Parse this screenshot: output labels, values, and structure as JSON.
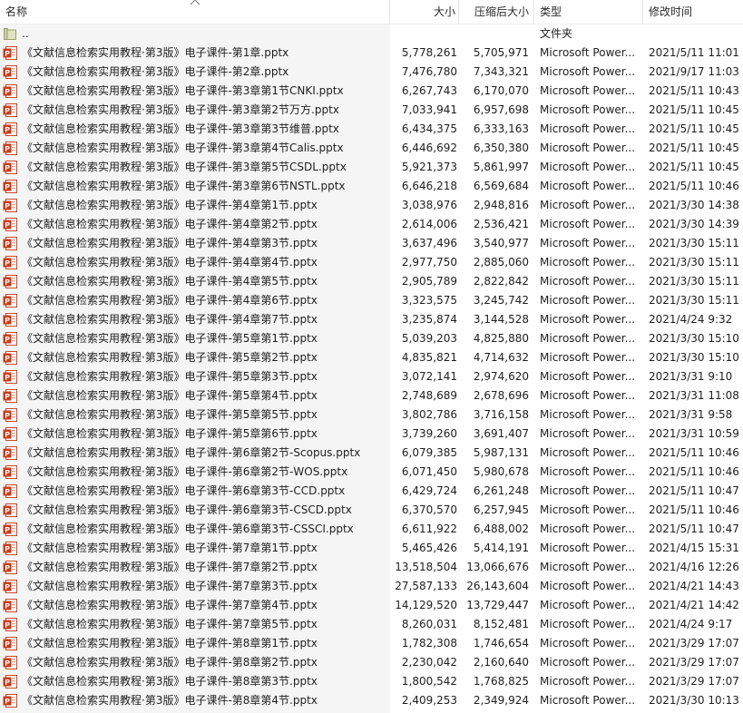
{
  "columns": {
    "name": "名称",
    "size": "大小",
    "compressed": "压缩后大小",
    "type": "类型",
    "modified": "修改时间"
  },
  "parent_row": {
    "name": "..",
    "type": "文件夹",
    "icon": "folder-icon"
  },
  "file_icon": "powerpoint-file-icon",
  "files": [
    {
      "name": "《文献信息检索实用教程·第3版》电子课件-第1章.pptx",
      "size": "5,778,261",
      "compressed": "5,705,971",
      "type": "Microsoft Power...",
      "modified": "2021/5/11 11:01"
    },
    {
      "name": "《文献信息检索实用教程·第3版》电子课件-第2章.pptx",
      "size": "7,476,780",
      "compressed": "7,343,321",
      "type": "Microsoft Power...",
      "modified": "2021/9/17 11:03"
    },
    {
      "name": "《文献信息检索实用教程·第3版》电子课件-第3章第1节CNKI.pptx",
      "size": "6,267,743",
      "compressed": "6,170,070",
      "type": "Microsoft Power...",
      "modified": "2021/5/11 10:43"
    },
    {
      "name": "《文献信息检索实用教程·第3版》电子课件-第3章第2节万方.pptx",
      "size": "7,033,941",
      "compressed": "6,957,698",
      "type": "Microsoft Power...",
      "modified": "2021/5/11 10:45"
    },
    {
      "name": "《文献信息检索实用教程·第3版》电子课件-第3章第3节维普.pptx",
      "size": "6,434,375",
      "compressed": "6,333,163",
      "type": "Microsoft Power...",
      "modified": "2021/5/11 10:45"
    },
    {
      "name": "《文献信息检索实用教程·第3版》电子课件-第3章第4节Calis.pptx",
      "size": "6,446,692",
      "compressed": "6,350,380",
      "type": "Microsoft Power...",
      "modified": "2021/5/11 10:45"
    },
    {
      "name": "《文献信息检索实用教程·第3版》电子课件-第3章第5节CSDL.pptx",
      "size": "5,921,373",
      "compressed": "5,861,997",
      "type": "Microsoft Power...",
      "modified": "2021/5/11 10:45"
    },
    {
      "name": "《文献信息检索实用教程·第3版》电子课件-第3章第6节NSTL.pptx",
      "size": "6,646,218",
      "compressed": "6,569,684",
      "type": "Microsoft Power...",
      "modified": "2021/5/11 10:46"
    },
    {
      "name": "《文献信息检索实用教程·第3版》电子课件-第4章第1节.pptx",
      "size": "3,038,976",
      "compressed": "2,948,816",
      "type": "Microsoft Power...",
      "modified": "2021/3/30 14:38"
    },
    {
      "name": "《文献信息检索实用教程·第3版》电子课件-第4章第2节.pptx",
      "size": "2,614,006",
      "compressed": "2,536,421",
      "type": "Microsoft Power...",
      "modified": "2021/3/30 14:39"
    },
    {
      "name": "《文献信息检索实用教程·第3版》电子课件-第4章第3节.pptx",
      "size": "3,637,496",
      "compressed": "3,540,977",
      "type": "Microsoft Power...",
      "modified": "2021/3/30 15:11"
    },
    {
      "name": "《文献信息检索实用教程·第3版》电子课件-第4章第4节.pptx",
      "size": "2,977,750",
      "compressed": "2,885,060",
      "type": "Microsoft Power...",
      "modified": "2021/3/30 15:11"
    },
    {
      "name": "《文献信息检索实用教程·第3版》电子课件-第4章第5节.pptx",
      "size": "2,905,789",
      "compressed": "2,822,842",
      "type": "Microsoft Power...",
      "modified": "2021/3/30 15:11"
    },
    {
      "name": "《文献信息检索实用教程·第3版》电子课件-第4章第6节.pptx",
      "size": "3,323,575",
      "compressed": "3,245,742",
      "type": "Microsoft Power...",
      "modified": "2021/3/30 15:11"
    },
    {
      "name": "《文献信息检索实用教程·第3版》电子课件-第4章第7节.pptx",
      "size": "3,235,874",
      "compressed": "3,144,528",
      "type": "Microsoft Power...",
      "modified": "2021/4/24 9:32"
    },
    {
      "name": "《文献信息检索实用教程·第3版》电子课件-第5章第1节.pptx",
      "size": "5,039,203",
      "compressed": "4,825,880",
      "type": "Microsoft Power...",
      "modified": "2021/3/30 15:10"
    },
    {
      "name": "《文献信息检索实用教程·第3版》电子课件-第5章第2节.pptx",
      "size": "4,835,821",
      "compressed": "4,714,632",
      "type": "Microsoft Power...",
      "modified": "2021/3/30 15:10"
    },
    {
      "name": "《文献信息检索实用教程·第3版》电子课件-第5章第3节.pptx",
      "size": "3,072,141",
      "compressed": "2,974,620",
      "type": "Microsoft Power...",
      "modified": "2021/3/31 9:10"
    },
    {
      "name": "《文献信息检索实用教程·第3版》电子课件-第5章第4节.pptx",
      "size": "2,748,689",
      "compressed": "2,678,696",
      "type": "Microsoft Power...",
      "modified": "2021/3/31 11:08"
    },
    {
      "name": "《文献信息检索实用教程·第3版》电子课件-第5章第5节.pptx",
      "size": "3,802,786",
      "compressed": "3,716,158",
      "type": "Microsoft Power...",
      "modified": "2021/3/31 9:58"
    },
    {
      "name": "《文献信息检索实用教程·第3版》电子课件-第5章第6节.pptx",
      "size": "3,739,260",
      "compressed": "3,691,407",
      "type": "Microsoft Power...",
      "modified": "2021/3/31 10:59"
    },
    {
      "name": "《文献信息检索实用教程·第3版》电子课件-第6章第2节-Scopus.pptx",
      "size": "6,079,385",
      "compressed": "5,987,131",
      "type": "Microsoft Power...",
      "modified": "2021/5/11 10:46"
    },
    {
      "name": "《文献信息检索实用教程·第3版》电子课件-第6章第2节-WOS.pptx",
      "size": "6,071,450",
      "compressed": "5,980,678",
      "type": "Microsoft Power...",
      "modified": "2021/5/11 10:46"
    },
    {
      "name": "《文献信息检索实用教程·第3版》电子课件-第6章第3节-CCD.pptx",
      "size": "6,429,724",
      "compressed": "6,261,248",
      "type": "Microsoft Power...",
      "modified": "2021/5/11 10:47"
    },
    {
      "name": "《文献信息检索实用教程·第3版》电子课件-第6章第3节-CSCD.pptx",
      "size": "6,370,570",
      "compressed": "6,257,945",
      "type": "Microsoft Power...",
      "modified": "2021/5/11 10:46"
    },
    {
      "name": "《文献信息检索实用教程·第3版》电子课件-第6章第3节-CSSCI.pptx",
      "size": "6,611,922",
      "compressed": "6,488,002",
      "type": "Microsoft Power...",
      "modified": "2021/5/11 10:47"
    },
    {
      "name": "《文献信息检索实用教程·第3版》电子课件-第7章第1节.pptx",
      "size": "5,465,426",
      "compressed": "5,414,191",
      "type": "Microsoft Power...",
      "modified": "2021/4/15 15:31"
    },
    {
      "name": "《文献信息检索实用教程·第3版》电子课件-第7章第2节.pptx",
      "size": "13,518,504",
      "compressed": "13,066,676",
      "type": "Microsoft Power...",
      "modified": "2021/4/16 12:26"
    },
    {
      "name": "《文献信息检索实用教程·第3版》电子课件-第7章第3节.pptx",
      "size": "27,587,133",
      "compressed": "26,143,604",
      "type": "Microsoft Power...",
      "modified": "2021/4/21 14:43"
    },
    {
      "name": "《文献信息检索实用教程·第3版》电子课件-第7章第4节.pptx",
      "size": "14,129,520",
      "compressed": "13,729,447",
      "type": "Microsoft Power...",
      "modified": "2021/4/21 14:42"
    },
    {
      "name": "《文献信息检索实用教程·第3版》电子课件-第7章第5节.pptx",
      "size": "8,260,031",
      "compressed": "8,152,481",
      "type": "Microsoft Power...",
      "modified": "2021/4/24 9:17"
    },
    {
      "name": "《文献信息检索实用教程·第3版》电子课件-第8章第1节.pptx",
      "size": "1,782,308",
      "compressed": "1,746,654",
      "type": "Microsoft Power...",
      "modified": "2021/3/29 17:07"
    },
    {
      "name": "《文献信息检索实用教程·第3版》电子课件-第8章第2节.pptx",
      "size": "2,230,042",
      "compressed": "2,160,640",
      "type": "Microsoft Power...",
      "modified": "2021/3/29 17:07"
    },
    {
      "name": "《文献信息检索实用教程·第3版》电子课件-第8章第3节.pptx",
      "size": "1,800,542",
      "compressed": "1,768,825",
      "type": "Microsoft Power...",
      "modified": "2021/3/29 17:07"
    },
    {
      "name": "《文献信息检索实用教程·第3版》电子课件-第8章第4节.pptx",
      "size": "2,409,253",
      "compressed": "2,349,924",
      "type": "Microsoft Power...",
      "modified": "2021/3/30 10:13"
    }
  ]
}
